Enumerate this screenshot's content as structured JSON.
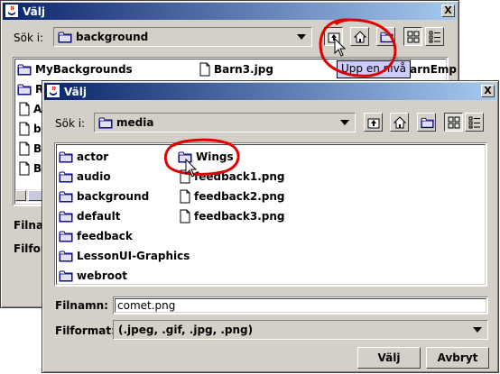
{
  "back_dialog": {
    "title": "Välj",
    "close": "X",
    "look_in_label": "Sök i:",
    "look_in_value": "background",
    "files": [
      {
        "name": "MyBackgrounds",
        "type": "folder"
      },
      {
        "name": "Barn3.jpg",
        "type": "file"
      },
      {
        "name": "BarnEmp",
        "type": "file"
      },
      {
        "name": "R",
        "type": "folder"
      },
      {
        "name": "A",
        "type": "file"
      },
      {
        "name": "ba",
        "type": "file"
      },
      {
        "name": "B",
        "type": "file"
      },
      {
        "name": "B",
        "type": "file"
      }
    ],
    "filename_label": "Filnamn:",
    "fileformat_label": "Filformat:",
    "tooltip": "Upp en nivå"
  },
  "front_dialog": {
    "title": "Välj",
    "close": "X",
    "look_in_label": "Sök i:",
    "look_in_value": "media",
    "folders_col1": [
      "actor",
      "audio",
      "background",
      "default",
      "feedback",
      "LessonUI-Graphics",
      "webroot"
    ],
    "col2": [
      {
        "name": "Wings",
        "type": "folder"
      },
      {
        "name": "feedback1.png",
        "type": "file"
      },
      {
        "name": "feedback2.png",
        "type": "file"
      },
      {
        "name": "feedback3.png",
        "type": "file"
      }
    ],
    "filename_label": "Filnamn:",
    "filename_value": "comet.png",
    "fileformat_label": "Filformat:",
    "fileformat_value": "(.jpeg, .gif, .jpg, .png)",
    "ok_button": "Välj",
    "cancel_button": "Avbryt"
  },
  "colors": {
    "title_start": "#0a246a",
    "title_end": "#a6caf0",
    "window_bg": "#d4d0c8",
    "highlight_ring": "#e00000",
    "tooltip_bg": "#ccccff"
  }
}
